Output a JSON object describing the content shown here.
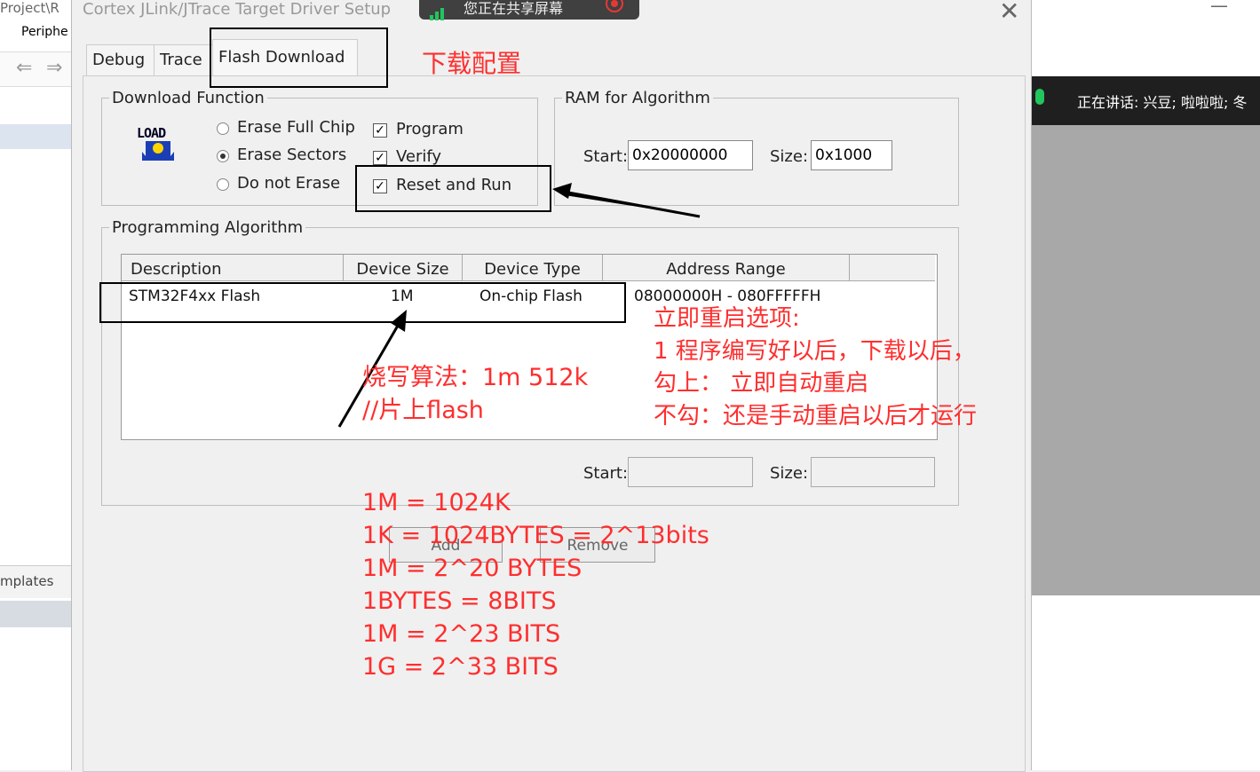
{
  "ide": {
    "title_fragment": "Project\\R",
    "menu_fragment": "Periphe",
    "tab_fragment": "mplates"
  },
  "share": {
    "text": "您正在共享屏幕"
  },
  "speaking": {
    "text": "正在讲话:  兴豆; 啦啦啦; 冬"
  },
  "dialog": {
    "title": "Cortex JLink/JTrace Target Driver Setup",
    "close": "✕",
    "tabs": [
      "Debug",
      "Trace",
      "Flash Download"
    ],
    "download_function": {
      "legend": "Download Function",
      "icon_text": "LOAD",
      "erase_options": [
        "Erase Full Chip",
        "Erase Sectors",
        "Do not Erase"
      ],
      "selected_erase": "Erase Sectors",
      "checks": [
        {
          "label": "Program",
          "checked": true
        },
        {
          "label": "Verify",
          "checked": true
        },
        {
          "label": "Reset and Run",
          "checked": true
        }
      ]
    },
    "ram": {
      "legend": "RAM for Algorithm",
      "start_label": "Start:",
      "start_value": "0x20000000",
      "size_label": "Size:",
      "size_value": "0x1000"
    },
    "algo": {
      "legend": "Programming Algorithm",
      "columns": [
        "Description",
        "Device Size",
        "Device Type",
        "Address Range"
      ],
      "rows": [
        {
          "description": "STM32F4xx Flash",
          "size": "1M",
          "type": "On-chip Flash",
          "range": "08000000H - 080FFFFFH"
        }
      ],
      "start_label": "Start:",
      "size_label": "Size:",
      "start_value": "",
      "size_value": ""
    },
    "buttons": {
      "add": "Add",
      "remove": "Remove"
    }
  },
  "annotations": {
    "tab_note": "下载配置",
    "reset_note": [
      "立即重启选项:",
      "1 程序编写好以后，下载以后，",
      "勾上：  立即自动重启",
      "不勾：还是手动重启以后才运行"
    ],
    "algo_note": [
      "烧写算法：1m 512k",
      "//片上flash"
    ],
    "size_notes": [
      "1M = 1024K",
      "1K = 1024BYTES = 2^13bits",
      "1M = 2^20  BYTES",
      "1BYTES = 8BITS",
      "1M = 2^23  BITS",
      "1G = 2^33 BITS"
    ]
  },
  "colors": {
    "annotation": "#ff2e2e"
  }
}
